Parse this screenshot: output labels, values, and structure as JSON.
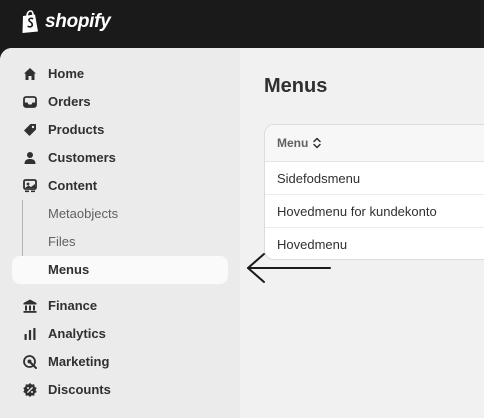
{
  "app": {
    "brand": "shopify"
  },
  "sidebar": {
    "items": [
      {
        "label": "Home",
        "icon": "home-icon"
      },
      {
        "label": "Orders",
        "icon": "inbox-icon"
      },
      {
        "label": "Products",
        "icon": "tag-icon"
      },
      {
        "label": "Customers",
        "icon": "person-icon"
      },
      {
        "label": "Content",
        "icon": "content-icon"
      },
      {
        "label": "Metaobjects"
      },
      {
        "label": "Files"
      },
      {
        "label": "Menus",
        "active": true
      },
      {
        "label": "Finance",
        "icon": "bank-icon"
      },
      {
        "label": "Analytics",
        "icon": "bar-chart-icon"
      },
      {
        "label": "Marketing",
        "icon": "target-icon"
      },
      {
        "label": "Discounts",
        "icon": "discount-icon"
      }
    ]
  },
  "main": {
    "title": "Menus",
    "table": {
      "column_header": "Menu",
      "rows": [
        "Sidefodsmenu",
        "Hovedmenu for kundekonto",
        "Hovedmenu"
      ]
    }
  },
  "colors": {
    "topbar": "#1a1a1a",
    "sidebar": "#ebebeb",
    "main": "#f1f1f1",
    "text": "#303030"
  }
}
